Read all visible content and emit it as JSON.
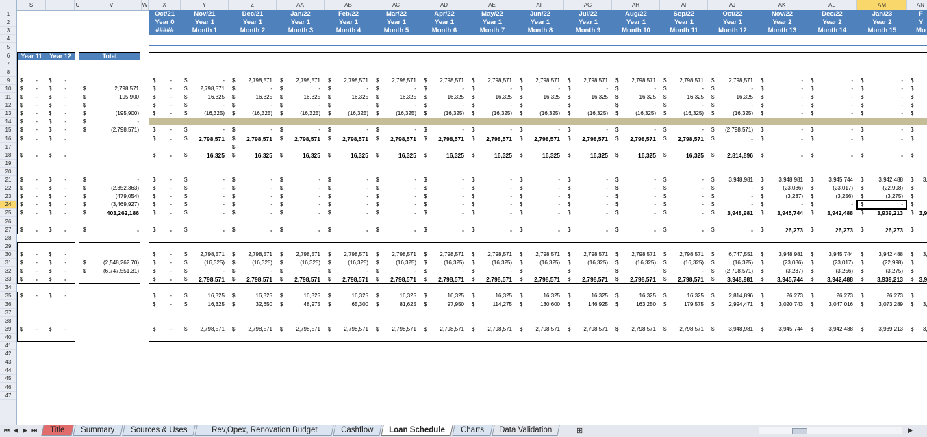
{
  "columns": [
    {
      "label": "S",
      "w": 42
    },
    {
      "label": "T",
      "w": 42
    },
    {
      "label": "U",
      "w": 10
    },
    {
      "label": "V",
      "w": 88
    },
    {
      "label": "W",
      "w": 10
    },
    {
      "label": "X",
      "w": 47
    },
    {
      "label": "Y",
      "w": 70
    },
    {
      "label": "Z",
      "w": 70
    },
    {
      "label": "AA",
      "w": 70
    },
    {
      "label": "AB",
      "w": 70
    },
    {
      "label": "AC",
      "w": 70
    },
    {
      "label": "AD",
      "w": 70
    },
    {
      "label": "AE",
      "w": 70
    },
    {
      "label": "AF",
      "w": 70
    },
    {
      "label": "AG",
      "w": 70
    },
    {
      "label": "AH",
      "w": 70
    },
    {
      "label": "AI",
      "w": 70
    },
    {
      "label": "AJ",
      "w": 72
    },
    {
      "label": "AK",
      "w": 73
    },
    {
      "label": "AL",
      "w": 73
    },
    {
      "label": "AM",
      "w": 73
    },
    {
      "label": "AN",
      "w": 40
    }
  ],
  "selected_column": "AM",
  "selected_row": "24",
  "row_numbers": [
    "1",
    "2",
    "3",
    "4",
    "5",
    "6",
    "7",
    "8",
    "9",
    "10",
    "11",
    "12",
    "13",
    "14",
    "15",
    "16",
    "17",
    "18",
    "19",
    "20",
    "21",
    "22",
    "23",
    "24",
    "25",
    "26",
    "27",
    "28",
    "29",
    "30",
    "31",
    "32",
    "33",
    "34",
    "35",
    "36",
    "37",
    "38",
    "39",
    "40",
    "41",
    "42",
    "43",
    "44",
    "45",
    "46",
    "47"
  ],
  "period_headers": [
    {
      "month": "Oct/21",
      "year": "Year 0",
      "period": "#####"
    },
    {
      "month": "Nov/21",
      "year": "Year 1",
      "period": "Month 1"
    },
    {
      "month": "Dec/21",
      "year": "Year 1",
      "period": "Month 2"
    },
    {
      "month": "Jan/22",
      "year": "Year 1",
      "period": "Month 3"
    },
    {
      "month": "Feb/22",
      "year": "Year 1",
      "period": "Month 4"
    },
    {
      "month": "Mar/22",
      "year": "Year 1",
      "period": "Month 5"
    },
    {
      "month": "Apr/22",
      "year": "Year 1",
      "period": "Month 6"
    },
    {
      "month": "May/22",
      "year": "Year 1",
      "period": "Month 7"
    },
    {
      "month": "Jun/22",
      "year": "Year 1",
      "period": "Month 8"
    },
    {
      "month": "Jul/22",
      "year": "Year 1",
      "period": "Month 9"
    },
    {
      "month": "Aug/22",
      "year": "Year 1",
      "period": "Month 10"
    },
    {
      "month": "Sep/22",
      "year": "Year 1",
      "period": "Month 11"
    },
    {
      "month": "Oct/22",
      "year": "Year 1",
      "period": "Month 12"
    },
    {
      "month": "Nov/22",
      "year": "Year 2",
      "period": "Month 13"
    },
    {
      "month": "Dec/22",
      "year": "Year 2",
      "period": "Month 14"
    },
    {
      "month": "Jan/23",
      "year": "Year 2",
      "period": "Month 15"
    },
    {
      "month": "F",
      "year": "Y",
      "period": "Mo"
    }
  ],
  "summary_headers": {
    "year11": "Year 11",
    "year12": "Year 12",
    "total": "Total"
  },
  "rows": [
    {
      "r": 9,
      "st": [
        "-",
        "-"
      ],
      "v": "",
      "x": "-",
      "m": [
        "-",
        "2,798,571",
        "2,798,571",
        "2,798,571",
        "2,798,571",
        "2,798,571",
        "2,798,571",
        "2,798,571",
        "2,798,571",
        "2,798,571",
        "2,798,571",
        "2,798,571",
        "-",
        "-",
        "-",
        "-"
      ]
    },
    {
      "r": 10,
      "st": [
        "-",
        "-"
      ],
      "v": "2,798,571",
      "x": "-",
      "m": [
        "2,798,571",
        "-",
        "-",
        "-",
        "-",
        "-",
        "-",
        "-",
        "-",
        "-",
        "-",
        "-",
        "-",
        "-",
        "-",
        "-"
      ]
    },
    {
      "r": 11,
      "st": [
        "-",
        "-"
      ],
      "v": "195,900",
      "x": "-",
      "m": [
        "16,325",
        "16,325",
        "16,325",
        "16,325",
        "16,325",
        "16,325",
        "16,325",
        "16,325",
        "16,325",
        "16,325",
        "16,325",
        "16,325",
        "-",
        "-",
        "-",
        "-"
      ]
    },
    {
      "r": 12,
      "st": [
        "-",
        "-"
      ],
      "v": "-",
      "x": "-",
      "m": [
        "-",
        "-",
        "-",
        "-",
        "-",
        "-",
        "-",
        "-",
        "-",
        "-",
        "-",
        "-",
        "-",
        "-",
        "-",
        "-"
      ]
    },
    {
      "r": 13,
      "st": [
        "-",
        "-"
      ],
      "v": "(195,900)",
      "x": "-",
      "m": [
        "(16,325)",
        "(16,325)",
        "(16,325)",
        "(16,325)",
        "(16,325)",
        "(16,325)",
        "(16,325)",
        "(16,325)",
        "(16,325)",
        "(16,325)",
        "(16,325)",
        "(16,325)",
        "-",
        "-",
        "-",
        "-"
      ]
    },
    {
      "r": 14,
      "st": [
        "-",
        "-"
      ],
      "v": "-",
      "x": "",
      "m": []
    },
    {
      "r": 15,
      "st": [
        "-",
        "-"
      ],
      "v": "(2,798,571)",
      "x": "-",
      "m": [
        "-",
        "-",
        "-",
        "-",
        "-",
        "-",
        "-",
        "-",
        "-",
        "-",
        "-",
        "(2,798,571)",
        "-",
        "-",
        "-",
        "-"
      ]
    },
    {
      "r": 16,
      "bold": true,
      "st": [
        "-",
        "-"
      ],
      "v": "",
      "x": "-",
      "m": [
        "2,798,571",
        "2,798,571",
        "2,798,571",
        "2,798,571",
        "2,798,571",
        "2,798,571",
        "2,798,571",
        "2,798,571",
        "2,798,571",
        "2,798,571",
        "2,798,571",
        "-",
        "-",
        "-",
        "-",
        "-"
      ]
    },
    {
      "r": 18,
      "bold": true,
      "st": [
        "-",
        "-"
      ],
      "v": "",
      "x": "-",
      "m": [
        "16,325",
        "16,325",
        "16,325",
        "16,325",
        "16,325",
        "16,325",
        "16,325",
        "16,325",
        "16,325",
        "16,325",
        "16,325",
        "2,814,896",
        "-",
        "-",
        "-",
        "-"
      ]
    },
    {
      "r": 21,
      "st": [
        "-",
        "-"
      ],
      "v": "-",
      "x": "-",
      "m": [
        "-",
        "-",
        "-",
        "-",
        "-",
        "-",
        "-",
        "-",
        "-",
        "-",
        "-",
        "3,948,981",
        "3,948,981",
        "3,945,744",
        "3,942,488",
        "3,9"
      ]
    },
    {
      "r": 22,
      "st": [
        "-",
        "-"
      ],
      "v": "(2,352,363)",
      "x": "-",
      "m": [
        "-",
        "-",
        "-",
        "-",
        "-",
        "-",
        "-",
        "-",
        "-",
        "-",
        "-",
        "-",
        "(23,036)",
        "(23,017)",
        "(22,998)",
        "("
      ]
    },
    {
      "r": 23,
      "st": [
        "-",
        "-"
      ],
      "v": "(479,054)",
      "x": "-",
      "m": [
        "-",
        "-",
        "-",
        "-",
        "-",
        "-",
        "-",
        "-",
        "-",
        "-",
        "-",
        "-",
        "(3,237)",
        "(3,256)",
        "(3,275)",
        ""
      ]
    },
    {
      "r": 24,
      "st": [
        "-",
        "-"
      ],
      "v": "(3,469,927)",
      "x": "-",
      "m": [
        "-",
        "-",
        "-",
        "-",
        "-",
        "-",
        "-",
        "-",
        "-",
        "-",
        "-",
        "-",
        "-",
        "-",
        "-",
        ""
      ]
    },
    {
      "r": 25,
      "bold": true,
      "st": [
        "-",
        "-"
      ],
      "v": "403,262,186",
      "x": "-",
      "m": [
        "-",
        "-",
        "-",
        "-",
        "-",
        "-",
        "-",
        "-",
        "-",
        "-",
        "-",
        "3,948,981",
        "3,945,744",
        "3,942,488",
        "3,939,213",
        "3,93"
      ]
    },
    {
      "r": 27,
      "bold": true,
      "st": [
        "-",
        "-"
      ],
      "v": "-",
      "x": "-",
      "m": [
        "-",
        "-",
        "-",
        "-",
        "-",
        "-",
        "-",
        "-",
        "-",
        "-",
        "-",
        "-",
        "26,273",
        "26,273",
        "26,273",
        "2"
      ]
    },
    {
      "r": 30,
      "st": [
        "-",
        "-"
      ],
      "v": "",
      "x": "-",
      "m": [
        "2,798,571",
        "2,798,571",
        "2,798,571",
        "2,798,571",
        "2,798,571",
        "2,798,571",
        "2,798,571",
        "2,798,571",
        "2,798,571",
        "2,798,571",
        "2,798,571",
        "6,747,551",
        "3,948,981",
        "3,945,744",
        "3,942,488",
        "3,9"
      ]
    },
    {
      "r": 31,
      "st": [
        "-",
        "-"
      ],
      "v": "(2,548,262.70)",
      "x": "-",
      "m": [
        "(16,325)",
        "(16,325)",
        "(16,325)",
        "(16,325)",
        "(16,325)",
        "(16,325)",
        "(16,325)",
        "(16,325)",
        "(16,325)",
        "(16,325)",
        "(16,325)",
        "(16,325)",
        "(23,036)",
        "(23,017)",
        "(22,998)",
        "("
      ]
    },
    {
      "r": 32,
      "st": [
        "-",
        "-"
      ],
      "v": "(6,747,551.31)",
      "x": "-",
      "m": [
        "-",
        "-",
        "-",
        "-",
        "-",
        "-",
        "-",
        "-",
        "-",
        "-",
        "-",
        "(2,798,571)",
        "(3,237)",
        "(3,256)",
        "(3,275)",
        ""
      ]
    },
    {
      "r": 33,
      "bold": true,
      "st": [
        "-",
        "-"
      ],
      "v": "",
      "x": "-",
      "m": [
        "2,798,571",
        "2,798,571",
        "2,798,571",
        "2,798,571",
        "2,798,571",
        "2,798,571",
        "2,798,571",
        "2,798,571",
        "2,798,571",
        "2,798,571",
        "2,798,571",
        "3,948,981",
        "3,945,744",
        "3,942,488",
        "3,939,213",
        "3,93"
      ]
    },
    {
      "r": 35,
      "st": [
        "-",
        "-"
      ],
      "v": "",
      "x": "-",
      "m": [
        "16,325",
        "16,325",
        "16,325",
        "16,325",
        "16,325",
        "16,325",
        "16,325",
        "16,325",
        "16,325",
        "16,325",
        "16,325",
        "2,814,896",
        "26,273",
        "26,273",
        "26,273",
        "2"
      ]
    },
    {
      "r": 36,
      "st": [
        "",
        ""
      ],
      "v": "",
      "x": "-",
      "m": [
        "16,325",
        "32,650",
        "48,975",
        "65,300",
        "81,625",
        "97,950",
        "114,275",
        "130,600",
        "146,925",
        "163,250",
        "179,575",
        "2,994,471",
        "3,020,743",
        "3,047,016",
        "3,073,289",
        "3,0"
      ]
    },
    {
      "r": 39,
      "st": [
        "-",
        "-"
      ],
      "v": "",
      "x": "-",
      "m": [
        "2,798,571",
        "2,798,571",
        "2,798,571",
        "2,798,571",
        "2,798,571",
        "2,798,571",
        "2,798,571",
        "2,798,571",
        "2,798,571",
        "2,798,571",
        "2,798,571",
        "3,948,981",
        "3,945,744",
        "3,942,488",
        "3,939,213",
        "3,9"
      ]
    }
  ],
  "sheet_tabs": [
    {
      "label": "Title",
      "color": "#e26b6b"
    },
    {
      "label": "Summary",
      "color": "#dbe5f1"
    },
    {
      "label": "Sources & Uses",
      "color": "#dbe5f1"
    },
    {
      "label": "Rev,Opex, Renovation Budget",
      "color": "#dbe5f1"
    },
    {
      "label": "Cashflow",
      "color": "#dbe5f1"
    },
    {
      "label": "Loan Schedule",
      "color": "#ffffff",
      "active": true
    },
    {
      "label": "Charts",
      "color": "#dbe5f1"
    },
    {
      "label": "Data Validation",
      "color": "#e4e8ee"
    }
  ],
  "dollar": "$"
}
